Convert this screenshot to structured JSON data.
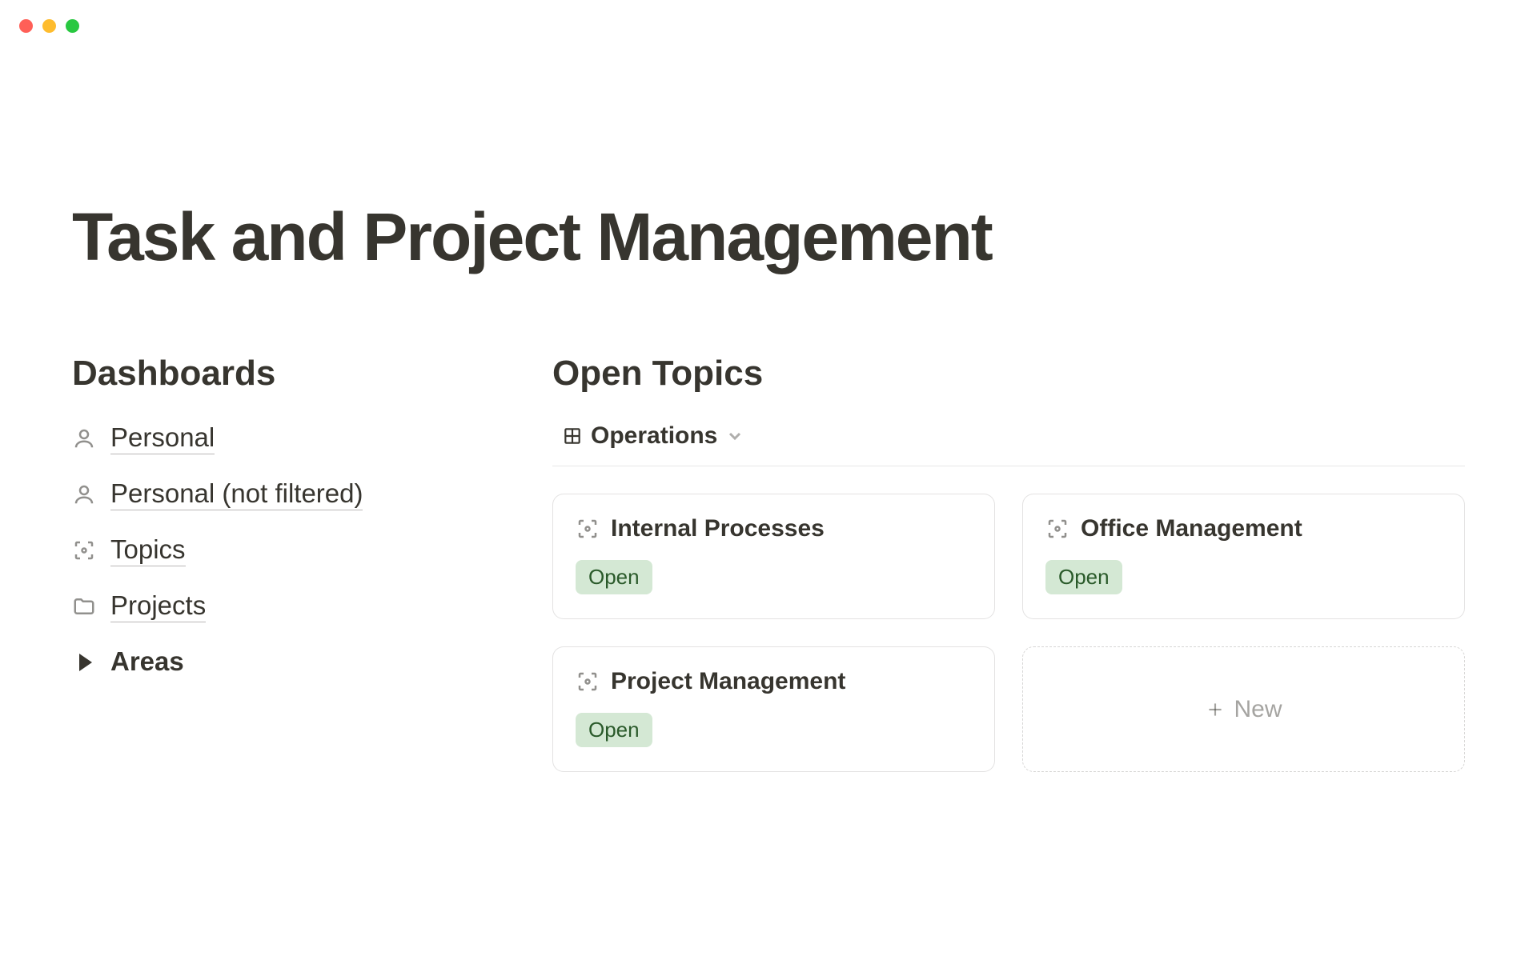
{
  "window": {
    "title": "Task and Project Management"
  },
  "left": {
    "heading": "Dashboards",
    "items": [
      {
        "icon": "person",
        "label": "Personal",
        "underline": true
      },
      {
        "icon": "person",
        "label": "Personal (not filtered)",
        "underline": true
      },
      {
        "icon": "scan",
        "label": "Topics",
        "underline": true
      },
      {
        "icon": "folder",
        "label": "Projects",
        "underline": true
      },
      {
        "icon": "triangle",
        "label": "Areas",
        "underline": false
      }
    ]
  },
  "right": {
    "heading": "Open Topics",
    "view": {
      "icon": "grid",
      "label": "Operations"
    },
    "cards": [
      {
        "title": "Internal Processes",
        "status": "Open"
      },
      {
        "title": "Office Management",
        "status": "Open"
      },
      {
        "title": "Project Management",
        "status": "Open"
      }
    ],
    "new_label": "New"
  },
  "colors": {
    "badge_bg": "#d4e8d4",
    "badge_fg": "#2a5a2a"
  }
}
